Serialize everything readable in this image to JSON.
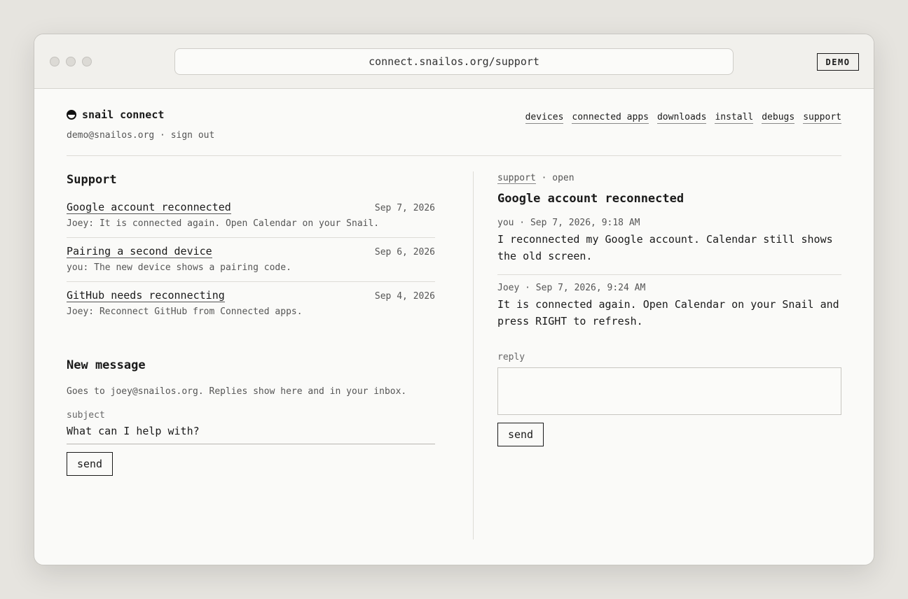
{
  "browser": {
    "url": "connect.snailos.org/support",
    "badge": "DEMO"
  },
  "header": {
    "brand": "snail connect",
    "account": "demo@snailos.org · sign out",
    "nav": [
      "devices",
      "connected apps",
      "downloads",
      "install",
      "debugs",
      "support"
    ]
  },
  "support": {
    "title": "Support",
    "threads": [
      {
        "title": "Google account reconnected",
        "date": "Sep 7, 2026",
        "preview": "Joey: It is connected again. Open Calendar on your Snail."
      },
      {
        "title": "Pairing a second device",
        "date": "Sep 6, 2026",
        "preview": "you: The new device shows a pairing code."
      },
      {
        "title": "GitHub needs reconnecting",
        "date": "Sep 4, 2026",
        "preview": "Joey: Reconnect GitHub from Connected apps."
      }
    ]
  },
  "new_message": {
    "title": "New message",
    "hint": "Goes to joey@snailos.org. Replies show here and in your inbox.",
    "subject_label": "subject",
    "subject_placeholder": "What can I help with?",
    "send_label": "send"
  },
  "conversation": {
    "crumb_link": "support",
    "crumb_status": " · open",
    "title": "Google account reconnected",
    "messages": [
      {
        "meta": "you · Sep 7, 2026, 9:18 AM",
        "body": "I reconnected my Google account. Calendar still shows the old screen."
      },
      {
        "meta": "Joey · Sep 7, 2026, 9:24 AM",
        "body": "It is connected again. Open Calendar on your Snail and press RIGHT to refresh."
      }
    ],
    "reply_label": "reply",
    "send_label": "send"
  }
}
